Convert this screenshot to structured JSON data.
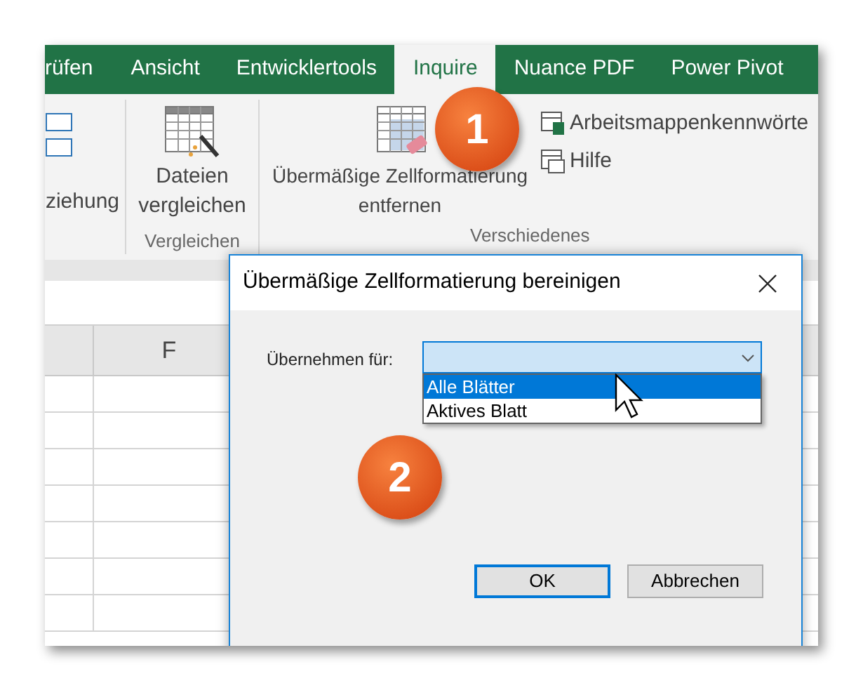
{
  "tabs": [
    {
      "label": "rüfen",
      "selected": false
    },
    {
      "label": "Ansicht",
      "selected": false
    },
    {
      "label": "Entwicklertools",
      "selected": false
    },
    {
      "label": "Inquire",
      "selected": true
    },
    {
      "label": "Nuance PDF",
      "selected": false
    },
    {
      "label": "Power Pivot",
      "selected": false
    }
  ],
  "ribbon": {
    "groups": [
      {
        "buttons": [
          {
            "label": "ziehung"
          }
        ]
      },
      {
        "label": "Vergleichen",
        "buttons": [
          {
            "label": "Dateien vergleichen"
          }
        ]
      },
      {
        "label": "Verschiedenes",
        "buttons": [
          {
            "label": "Übermäßige Zellformatierung entfernen"
          }
        ],
        "small_buttons": [
          "Arbeitsmappenkennwörte",
          "Hilfe"
        ]
      }
    ]
  },
  "sheet": {
    "columns": [
      "",
      "F"
    ]
  },
  "dialog": {
    "title": "Übermäßige Zellformatierung bereinigen",
    "field_label": "Übernehmen für:",
    "options": [
      {
        "label": "Alle Blätter",
        "selected": true
      },
      {
        "label": "Aktives Blatt",
        "selected": false
      }
    ],
    "buttons": [
      {
        "label": "OK",
        "default": true
      },
      {
        "label": "Abbrechen",
        "default": false
      }
    ]
  },
  "badges": [
    "1",
    "2"
  ]
}
